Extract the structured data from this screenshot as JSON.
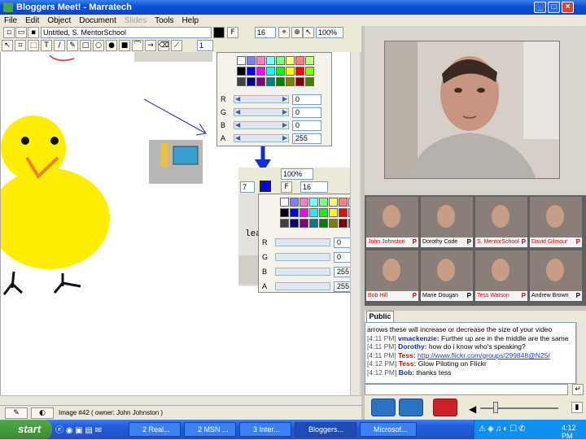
{
  "window": {
    "title": "Bloggers Meet! - Marratech",
    "controls": [
      "minimize",
      "maximize",
      "close"
    ]
  },
  "menu": [
    "File",
    "Edit",
    "Object",
    "Document",
    "Slides",
    "Tools",
    "Help"
  ],
  "toolbar": {
    "document_name": "Untitled, S. MentorSchool",
    "line_width": "1",
    "font_size": "16",
    "zoom": "100%"
  },
  "color_panel_small": {
    "rows": [
      {
        "label": "R",
        "value": "0"
      },
      {
        "label": "G",
        "value": "0"
      },
      {
        "label": "B",
        "value": "0"
      },
      {
        "label": "A",
        "value": "255"
      }
    ]
  },
  "pasted_image": {
    "zoom": "100%",
    "line_width": "7",
    "font_size": "16",
    "text_fragment": "lea",
    "rows": [
      {
        "label": "R",
        "value": "0"
      },
      {
        "label": "G",
        "value": "0"
      },
      {
        "label": "B",
        "value": "255"
      },
      {
        "label": "A",
        "value": "255"
      }
    ]
  },
  "status_bar": {
    "text": "Image #42 ( owner: John Johnston )"
  },
  "participants": [
    {
      "name": "John Johnston",
      "red": true
    },
    {
      "name": "Dorothy Code",
      "red": false
    },
    {
      "name": "S. MentorSchool",
      "red": true
    },
    {
      "name": "David Gilmour",
      "red": true
    },
    {
      "name": "Bob Hill",
      "red": true
    },
    {
      "name": "Marie Dougan",
      "red": false
    },
    {
      "name": "Tess Watson",
      "red": true
    },
    {
      "name": "Andrew Brown",
      "red": false
    }
  ],
  "participant_badge": "P",
  "chat": {
    "tab": "Public",
    "messages": [
      {
        "time": "",
        "name": "",
        "text": "arrows these will increase or decrease the size of your video",
        "red": false,
        "link": false
      },
      {
        "time": "[4:11 PM]",
        "name": "vmackenzie:",
        "text": "Further up are in the middle are the same",
        "red": false,
        "link": false
      },
      {
        "time": "[4:11 PM]",
        "name": "Dorothy:",
        "text": "how do i know who's speaking?",
        "red": false,
        "link": false
      },
      {
        "time": "[4:11 PM]",
        "name": "Tess:",
        "text": "http://www.flickr.com/groups/299848@N25/",
        "red": true,
        "link": true
      },
      {
        "time": "[4:12 PM]",
        "name": "Tess:",
        "text": "Glow Piloting on Flickr",
        "red": true,
        "link": false
      },
      {
        "time": "[4:12 PM]",
        "name": "Bob:",
        "text": "thanks tess",
        "red": false,
        "link": false
      }
    ]
  },
  "taskbar": {
    "start": "start",
    "tasks": [
      "2 Real...",
      "2 MSN ...",
      "3 Inter...",
      "Bloggers...",
      "Microsof..."
    ],
    "clock": "4:12 PM"
  },
  "colors": {
    "selected_swatch": "#0000ff",
    "chick": "#ffee00"
  }
}
